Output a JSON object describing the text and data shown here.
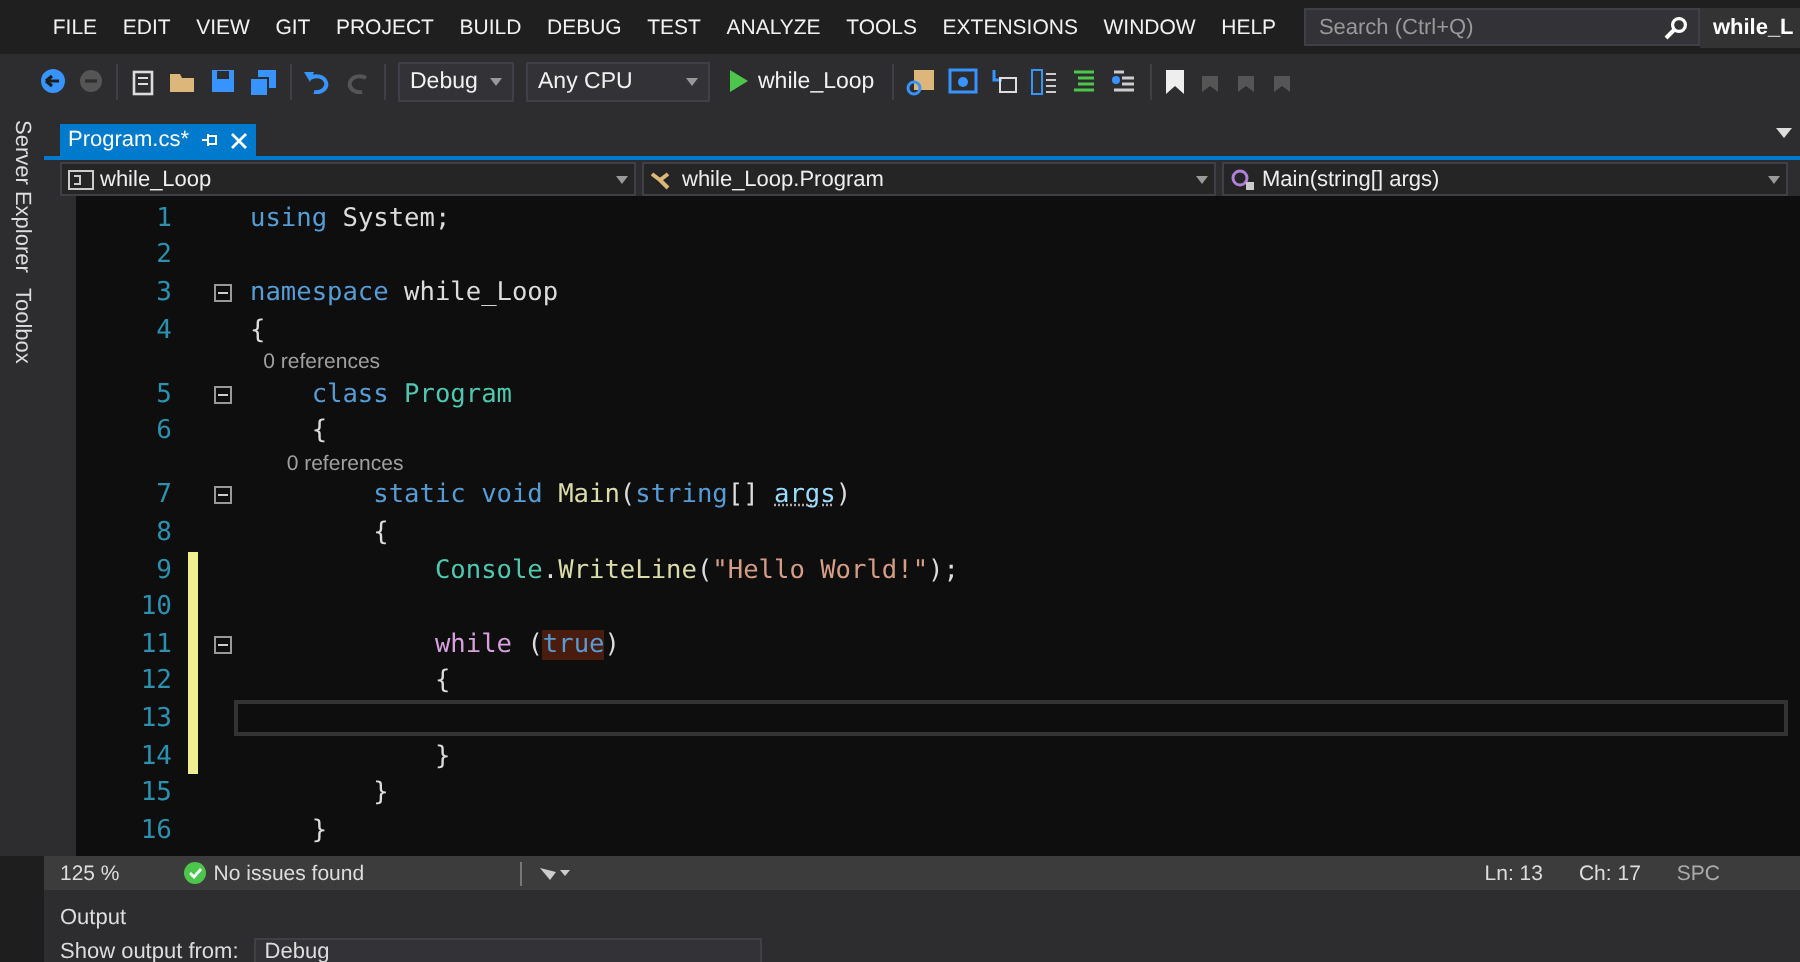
{
  "menu_bar": {
    "items": [
      "FILE",
      "EDIT",
      "VIEW",
      "GIT",
      "PROJECT",
      "BUILD",
      "DEBUG",
      "TEST",
      "ANALYZE",
      "TOOLS",
      "EXTENSIONS",
      "WINDOW",
      "HELP"
    ],
    "search": {
      "placeholder": "Search (Ctrl+Q)"
    },
    "solution_title": "while_L"
  },
  "toolbar": {
    "configuration": "Debug",
    "platform": "Any CPU",
    "run_target": "while_Loop"
  },
  "side_tabs": [
    "Server Explorer",
    "Toolbox"
  ],
  "tabs": [
    {
      "label": "Program.cs*",
      "selected": true
    }
  ],
  "nav_bar": {
    "project": "while_Loop",
    "type": "while_Loop.Program",
    "member": "Main(string[] args)"
  },
  "code_lines": [
    {
      "kind": "code",
      "number": "1",
      "fold": false,
      "changed": false,
      "current": false,
      "tokens": [
        {
          "kind": "keyword",
          "text": "using "
        },
        {
          "kind": "plain",
          "text": "System;"
        }
      ]
    },
    {
      "kind": "code",
      "number": "2",
      "fold": false,
      "changed": false,
      "current": false
    },
    {
      "kind": "code",
      "number": "3",
      "fold": true,
      "changed": false,
      "current": false,
      "tokens": [
        {
          "kind": "keyword",
          "text": "namespace "
        },
        {
          "kind": "plain",
          "text": "while_Loop"
        }
      ]
    },
    {
      "kind": "code",
      "number": "4",
      "fold": false,
      "changed": false,
      "current": false,
      "tokens": [
        {
          "kind": "plain",
          "text": "{"
        }
      ]
    },
    {
      "kind": "codelens",
      "text": "    0 references"
    },
    {
      "kind": "code",
      "number": "5",
      "fold": true,
      "changed": false,
      "current": false,
      "tokens": [
        {
          "kind": "keyword",
          "text": "    class "
        },
        {
          "kind": "type",
          "text": "Program"
        }
      ]
    },
    {
      "kind": "code",
      "number": "6",
      "fold": false,
      "changed": false,
      "current": false,
      "tokens": [
        {
          "kind": "plain",
          "text": "    {"
        }
      ]
    },
    {
      "kind": "codelens",
      "text": "        0 references"
    },
    {
      "kind": "code",
      "number": "7",
      "fold": true,
      "changed": false,
      "current": false,
      "tokens": [
        {
          "kind": "keyword",
          "text": "        static void "
        },
        {
          "kind": "method",
          "text": "Main"
        },
        {
          "kind": "plain",
          "text": "("
        },
        {
          "kind": "keyword",
          "text": "string"
        },
        {
          "kind": "plain",
          "text": "[] "
        },
        {
          "kind": "param",
          "text": "args",
          "hint": true
        },
        {
          "kind": "plain",
          "text": ")"
        }
      ]
    },
    {
      "kind": "code",
      "number": "8",
      "fold": false,
      "changed": false,
      "current": false,
      "tokens": [
        {
          "kind": "plain",
          "text": "        {"
        }
      ]
    },
    {
      "kind": "code",
      "number": "9",
      "fold": false,
      "changed": true,
      "current": false,
      "tokens": [
        {
          "kind": "type",
          "text": "            Console"
        },
        {
          "kind": "plain",
          "text": "."
        },
        {
          "kind": "method",
          "text": "WriteLine"
        },
        {
          "kind": "plain",
          "text": "("
        },
        {
          "kind": "string",
          "text": "\"Hello World!\""
        },
        {
          "kind": "plain",
          "text": ");"
        }
      ]
    },
    {
      "kind": "code",
      "number": "10",
      "fold": false,
      "changed": true,
      "current": false
    },
    {
      "kind": "code",
      "number": "11",
      "fold": true,
      "changed": true,
      "current": false,
      "tokens": [
        {
          "kind": "control",
          "text": "            while "
        },
        {
          "kind": "plain",
          "text": "("
        },
        {
          "kind": "keyword",
          "text": "true",
          "marked": true
        },
        {
          "kind": "plain",
          "text": ")"
        }
      ]
    },
    {
      "kind": "code",
      "number": "12",
      "fold": false,
      "changed": true,
      "current": false,
      "tokens": [
        {
          "kind": "plain",
          "text": "            {"
        }
      ]
    },
    {
      "kind": "code",
      "number": "13",
      "fold": false,
      "changed": true,
      "current": true
    },
    {
      "kind": "code",
      "number": "14",
      "fold": false,
      "changed": true,
      "current": false,
      "tokens": [
        {
          "kind": "plain",
          "text": "            }"
        }
      ]
    },
    {
      "kind": "code",
      "number": "15",
      "fold": false,
      "changed": false,
      "current": false,
      "tokens": [
        {
          "kind": "plain",
          "text": "        }"
        }
      ]
    },
    {
      "kind": "code",
      "number": "16",
      "fold": false,
      "changed": false,
      "current": false,
      "tokens": [
        {
          "kind": "plain",
          "text": "    }"
        }
      ]
    }
  ],
  "status_bar": {
    "zoom": "125 %",
    "issues": "No issues found",
    "line": "Ln: 13",
    "column": "Ch: 17",
    "whitespace": "SPC"
  },
  "output_panel": {
    "title": "Output",
    "source_label": "Show output from:",
    "source": "Debug"
  }
}
